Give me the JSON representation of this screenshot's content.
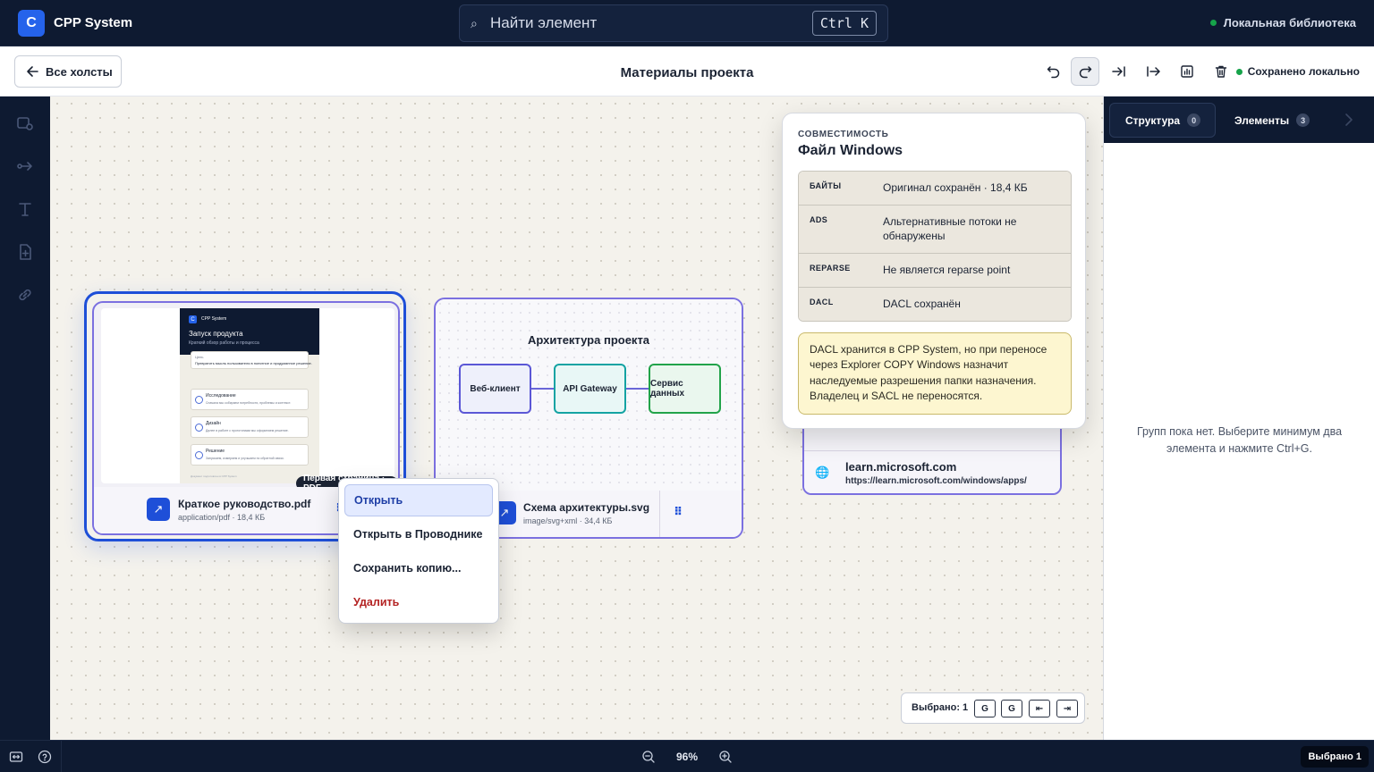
{
  "app": {
    "logo_letter": "C",
    "title": "CPP System"
  },
  "search": {
    "placeholder": "Найти элемент",
    "shortcut": "Ctrl K"
  },
  "library": {
    "label": "Локальная библиотека",
    "status_color": "#16a34a"
  },
  "subbar": {
    "back_label": "Все холсты",
    "page_title": "Материалы проекта",
    "saved_label": "Сохранено локально"
  },
  "pdf_card": {
    "name": "Краткое руководство.pdf",
    "meta": "application/pdf · 18,4 КБ",
    "preview_badge": "Первая страница · PDF",
    "preview": {
      "logo_letter": "C",
      "brand": "CPP System",
      "heading": "Запуск продукта",
      "subheading": "Краткий обзор работы и процесса",
      "intro_title": "Цель",
      "intro_text": "Превратить мысль пользователя в понятное и продуманное решение.",
      "items": [
        {
          "title": "Исследование",
          "text": "Сначала мы собираем потребности, проблемы и контекст."
        },
        {
          "title": "Дизайн",
          "text": "Далее в работе с прототипами мы оформляем решение."
        },
        {
          "title": "Решение",
          "text": "Запускаем, измеряем и улучшаем по обратной связи."
        }
      ],
      "footer": "Документ подготовлен в CPP System"
    }
  },
  "svg_card": {
    "name": "Схема архитектуры.svg",
    "meta": "image/svg+xml · 34,4 КБ",
    "diagram_title": "Архитектура проекта",
    "nodes": [
      {
        "label": "Веб-клиент",
        "border": "#5b57d6",
        "fill": "#eef0fb"
      },
      {
        "label": "API Gateway",
        "border": "#14a3a3",
        "fill": "#e8f7f6"
      },
      {
        "label": "Сервис данных",
        "border": "#22a34a",
        "fill": "#eaf7ee"
      }
    ]
  },
  "link_card": {
    "host": "learn.microsoft.com",
    "url": "https://learn.microsoft.com/windows/apps/"
  },
  "compat": {
    "eyebrow": "СОВМЕСТИМОСТЬ",
    "title": "Файл Windows",
    "rows": [
      {
        "key": "БАЙТЫ",
        "value": "Оригинал сохранён · 18,4 КБ"
      },
      {
        "key": "ADS",
        "value": "Альтернативные потоки не обнаружены"
      },
      {
        "key": "REPARSE",
        "value": "Не является reparse point"
      },
      {
        "key": "DACL",
        "value": "DACL сохранён"
      }
    ],
    "note": "DACL хранится в CPP System, но при переносе через Explorer COPY Windows назначит наследуемые разрешения папки назначения. Владелец и SACL не переносятся."
  },
  "context_menu": {
    "items": [
      "Открыть",
      "Открыть в Проводнике",
      "Сохранить копию...",
      "Удалить"
    ]
  },
  "selection_toolbar": {
    "label": "Выбрано: 1",
    "buttons": [
      "G",
      "G",
      "⇤",
      "⇥"
    ]
  },
  "right_panel": {
    "tabs": [
      {
        "label": "Структура",
        "count": "0"
      },
      {
        "label": "Элементы",
        "count": "3"
      }
    ],
    "empty_message": "Групп пока нет. Выберите минимум два элемента и нажмите Ctrl+G."
  },
  "bottombar": {
    "zoom": "96%",
    "selected": "Выбрано 1"
  },
  "colors": {
    "accent": "#1e4fd8",
    "dark": "#0e1a31",
    "danger": "#b42323",
    "note_bg": "#fdf6d0"
  }
}
